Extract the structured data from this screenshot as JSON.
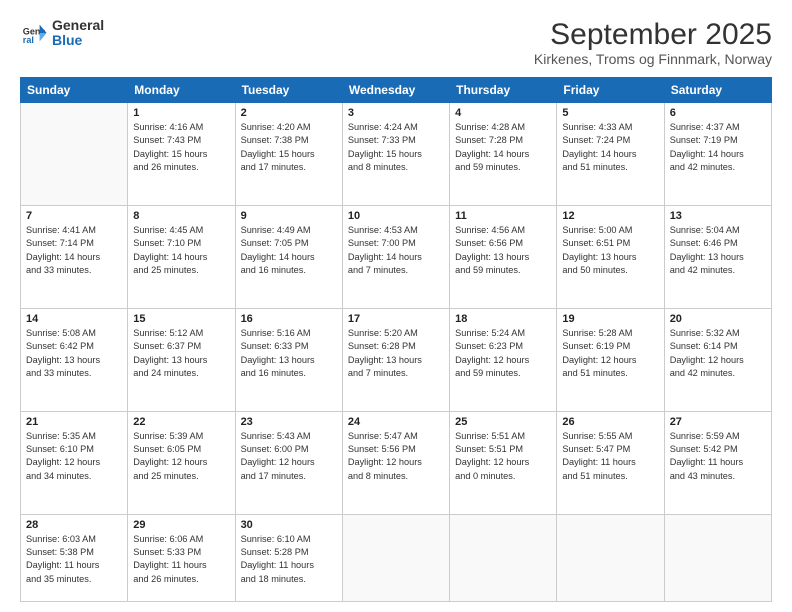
{
  "header": {
    "logo_general": "General",
    "logo_blue": "Blue",
    "title": "September 2025",
    "subtitle": "Kirkenes, Troms og Finnmark, Norway"
  },
  "weekdays": [
    "Sunday",
    "Monday",
    "Tuesday",
    "Wednesday",
    "Thursday",
    "Friday",
    "Saturday"
  ],
  "weeks": [
    [
      {
        "day": "",
        "info": ""
      },
      {
        "day": "1",
        "info": "Sunrise: 4:16 AM\nSunset: 7:43 PM\nDaylight: 15 hours\nand 26 minutes."
      },
      {
        "day": "2",
        "info": "Sunrise: 4:20 AM\nSunset: 7:38 PM\nDaylight: 15 hours\nand 17 minutes."
      },
      {
        "day": "3",
        "info": "Sunrise: 4:24 AM\nSunset: 7:33 PM\nDaylight: 15 hours\nand 8 minutes."
      },
      {
        "day": "4",
        "info": "Sunrise: 4:28 AM\nSunset: 7:28 PM\nDaylight: 14 hours\nand 59 minutes."
      },
      {
        "day": "5",
        "info": "Sunrise: 4:33 AM\nSunset: 7:24 PM\nDaylight: 14 hours\nand 51 minutes."
      },
      {
        "day": "6",
        "info": "Sunrise: 4:37 AM\nSunset: 7:19 PM\nDaylight: 14 hours\nand 42 minutes."
      }
    ],
    [
      {
        "day": "7",
        "info": "Sunrise: 4:41 AM\nSunset: 7:14 PM\nDaylight: 14 hours\nand 33 minutes."
      },
      {
        "day": "8",
        "info": "Sunrise: 4:45 AM\nSunset: 7:10 PM\nDaylight: 14 hours\nand 25 minutes."
      },
      {
        "day": "9",
        "info": "Sunrise: 4:49 AM\nSunset: 7:05 PM\nDaylight: 14 hours\nand 16 minutes."
      },
      {
        "day": "10",
        "info": "Sunrise: 4:53 AM\nSunset: 7:00 PM\nDaylight: 14 hours\nand 7 minutes."
      },
      {
        "day": "11",
        "info": "Sunrise: 4:56 AM\nSunset: 6:56 PM\nDaylight: 13 hours\nand 59 minutes."
      },
      {
        "day": "12",
        "info": "Sunrise: 5:00 AM\nSunset: 6:51 PM\nDaylight: 13 hours\nand 50 minutes."
      },
      {
        "day": "13",
        "info": "Sunrise: 5:04 AM\nSunset: 6:46 PM\nDaylight: 13 hours\nand 42 minutes."
      }
    ],
    [
      {
        "day": "14",
        "info": "Sunrise: 5:08 AM\nSunset: 6:42 PM\nDaylight: 13 hours\nand 33 minutes."
      },
      {
        "day": "15",
        "info": "Sunrise: 5:12 AM\nSunset: 6:37 PM\nDaylight: 13 hours\nand 24 minutes."
      },
      {
        "day": "16",
        "info": "Sunrise: 5:16 AM\nSunset: 6:33 PM\nDaylight: 13 hours\nand 16 minutes."
      },
      {
        "day": "17",
        "info": "Sunrise: 5:20 AM\nSunset: 6:28 PM\nDaylight: 13 hours\nand 7 minutes."
      },
      {
        "day": "18",
        "info": "Sunrise: 5:24 AM\nSunset: 6:23 PM\nDaylight: 12 hours\nand 59 minutes."
      },
      {
        "day": "19",
        "info": "Sunrise: 5:28 AM\nSunset: 6:19 PM\nDaylight: 12 hours\nand 51 minutes."
      },
      {
        "day": "20",
        "info": "Sunrise: 5:32 AM\nSunset: 6:14 PM\nDaylight: 12 hours\nand 42 minutes."
      }
    ],
    [
      {
        "day": "21",
        "info": "Sunrise: 5:35 AM\nSunset: 6:10 PM\nDaylight: 12 hours\nand 34 minutes."
      },
      {
        "day": "22",
        "info": "Sunrise: 5:39 AM\nSunset: 6:05 PM\nDaylight: 12 hours\nand 25 minutes."
      },
      {
        "day": "23",
        "info": "Sunrise: 5:43 AM\nSunset: 6:00 PM\nDaylight: 12 hours\nand 17 minutes."
      },
      {
        "day": "24",
        "info": "Sunrise: 5:47 AM\nSunset: 5:56 PM\nDaylight: 12 hours\nand 8 minutes."
      },
      {
        "day": "25",
        "info": "Sunrise: 5:51 AM\nSunset: 5:51 PM\nDaylight: 12 hours\nand 0 minutes."
      },
      {
        "day": "26",
        "info": "Sunrise: 5:55 AM\nSunset: 5:47 PM\nDaylight: 11 hours\nand 51 minutes."
      },
      {
        "day": "27",
        "info": "Sunrise: 5:59 AM\nSunset: 5:42 PM\nDaylight: 11 hours\nand 43 minutes."
      }
    ],
    [
      {
        "day": "28",
        "info": "Sunrise: 6:03 AM\nSunset: 5:38 PM\nDaylight: 11 hours\nand 35 minutes."
      },
      {
        "day": "29",
        "info": "Sunrise: 6:06 AM\nSunset: 5:33 PM\nDaylight: 11 hours\nand 26 minutes."
      },
      {
        "day": "30",
        "info": "Sunrise: 6:10 AM\nSunset: 5:28 PM\nDaylight: 11 hours\nand 18 minutes."
      },
      {
        "day": "",
        "info": ""
      },
      {
        "day": "",
        "info": ""
      },
      {
        "day": "",
        "info": ""
      },
      {
        "day": "",
        "info": ""
      }
    ]
  ]
}
